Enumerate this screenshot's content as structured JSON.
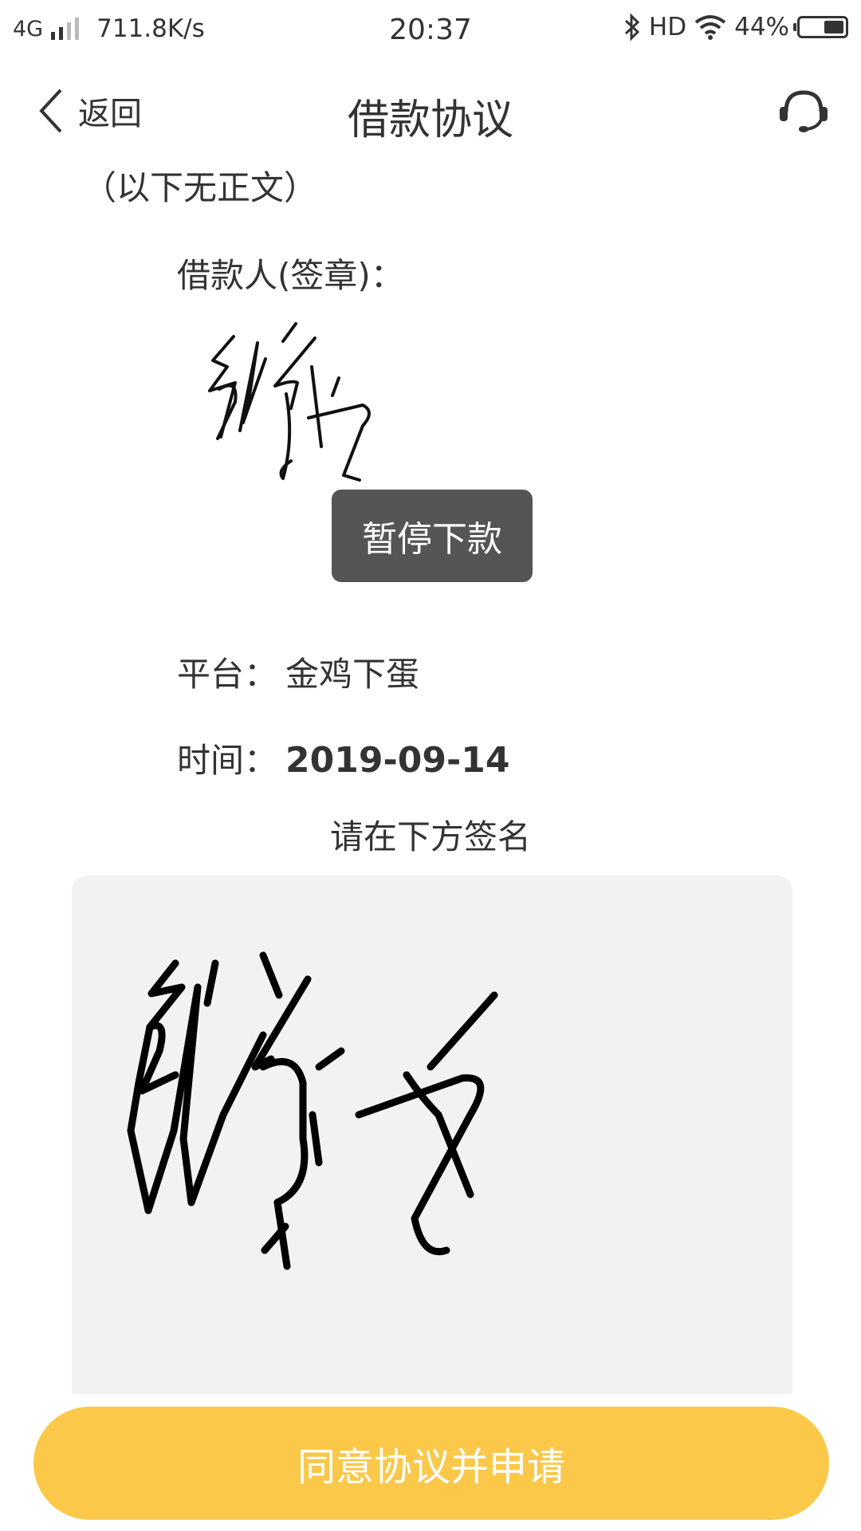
{
  "status_bar": {
    "network": "4G",
    "speed": "711.8K/s",
    "time": "20:37",
    "hd": "HD",
    "battery": "44%",
    "battery_level": 0.44
  },
  "nav": {
    "back_label": "返回",
    "title": "借款协议",
    "service_icon": "customer-service-headset-icon"
  },
  "contract": {
    "no_body_text": "（以下无正文）",
    "borrower_label": "借款人(签章)：",
    "platform_label": "平台：",
    "platform_value": "金鸡下蛋",
    "time_label": "时间：",
    "date_value": "2019-09-14"
  },
  "toast": {
    "message": "暂停下款"
  },
  "signature": {
    "hint": "请在下方签名"
  },
  "actions": {
    "agree_label": "同意协议并申请"
  },
  "colors": {
    "accent": "#fbc84a",
    "toast_bg": "#555555",
    "pad_bg": "#f2f2f2",
    "text": "#333333"
  }
}
